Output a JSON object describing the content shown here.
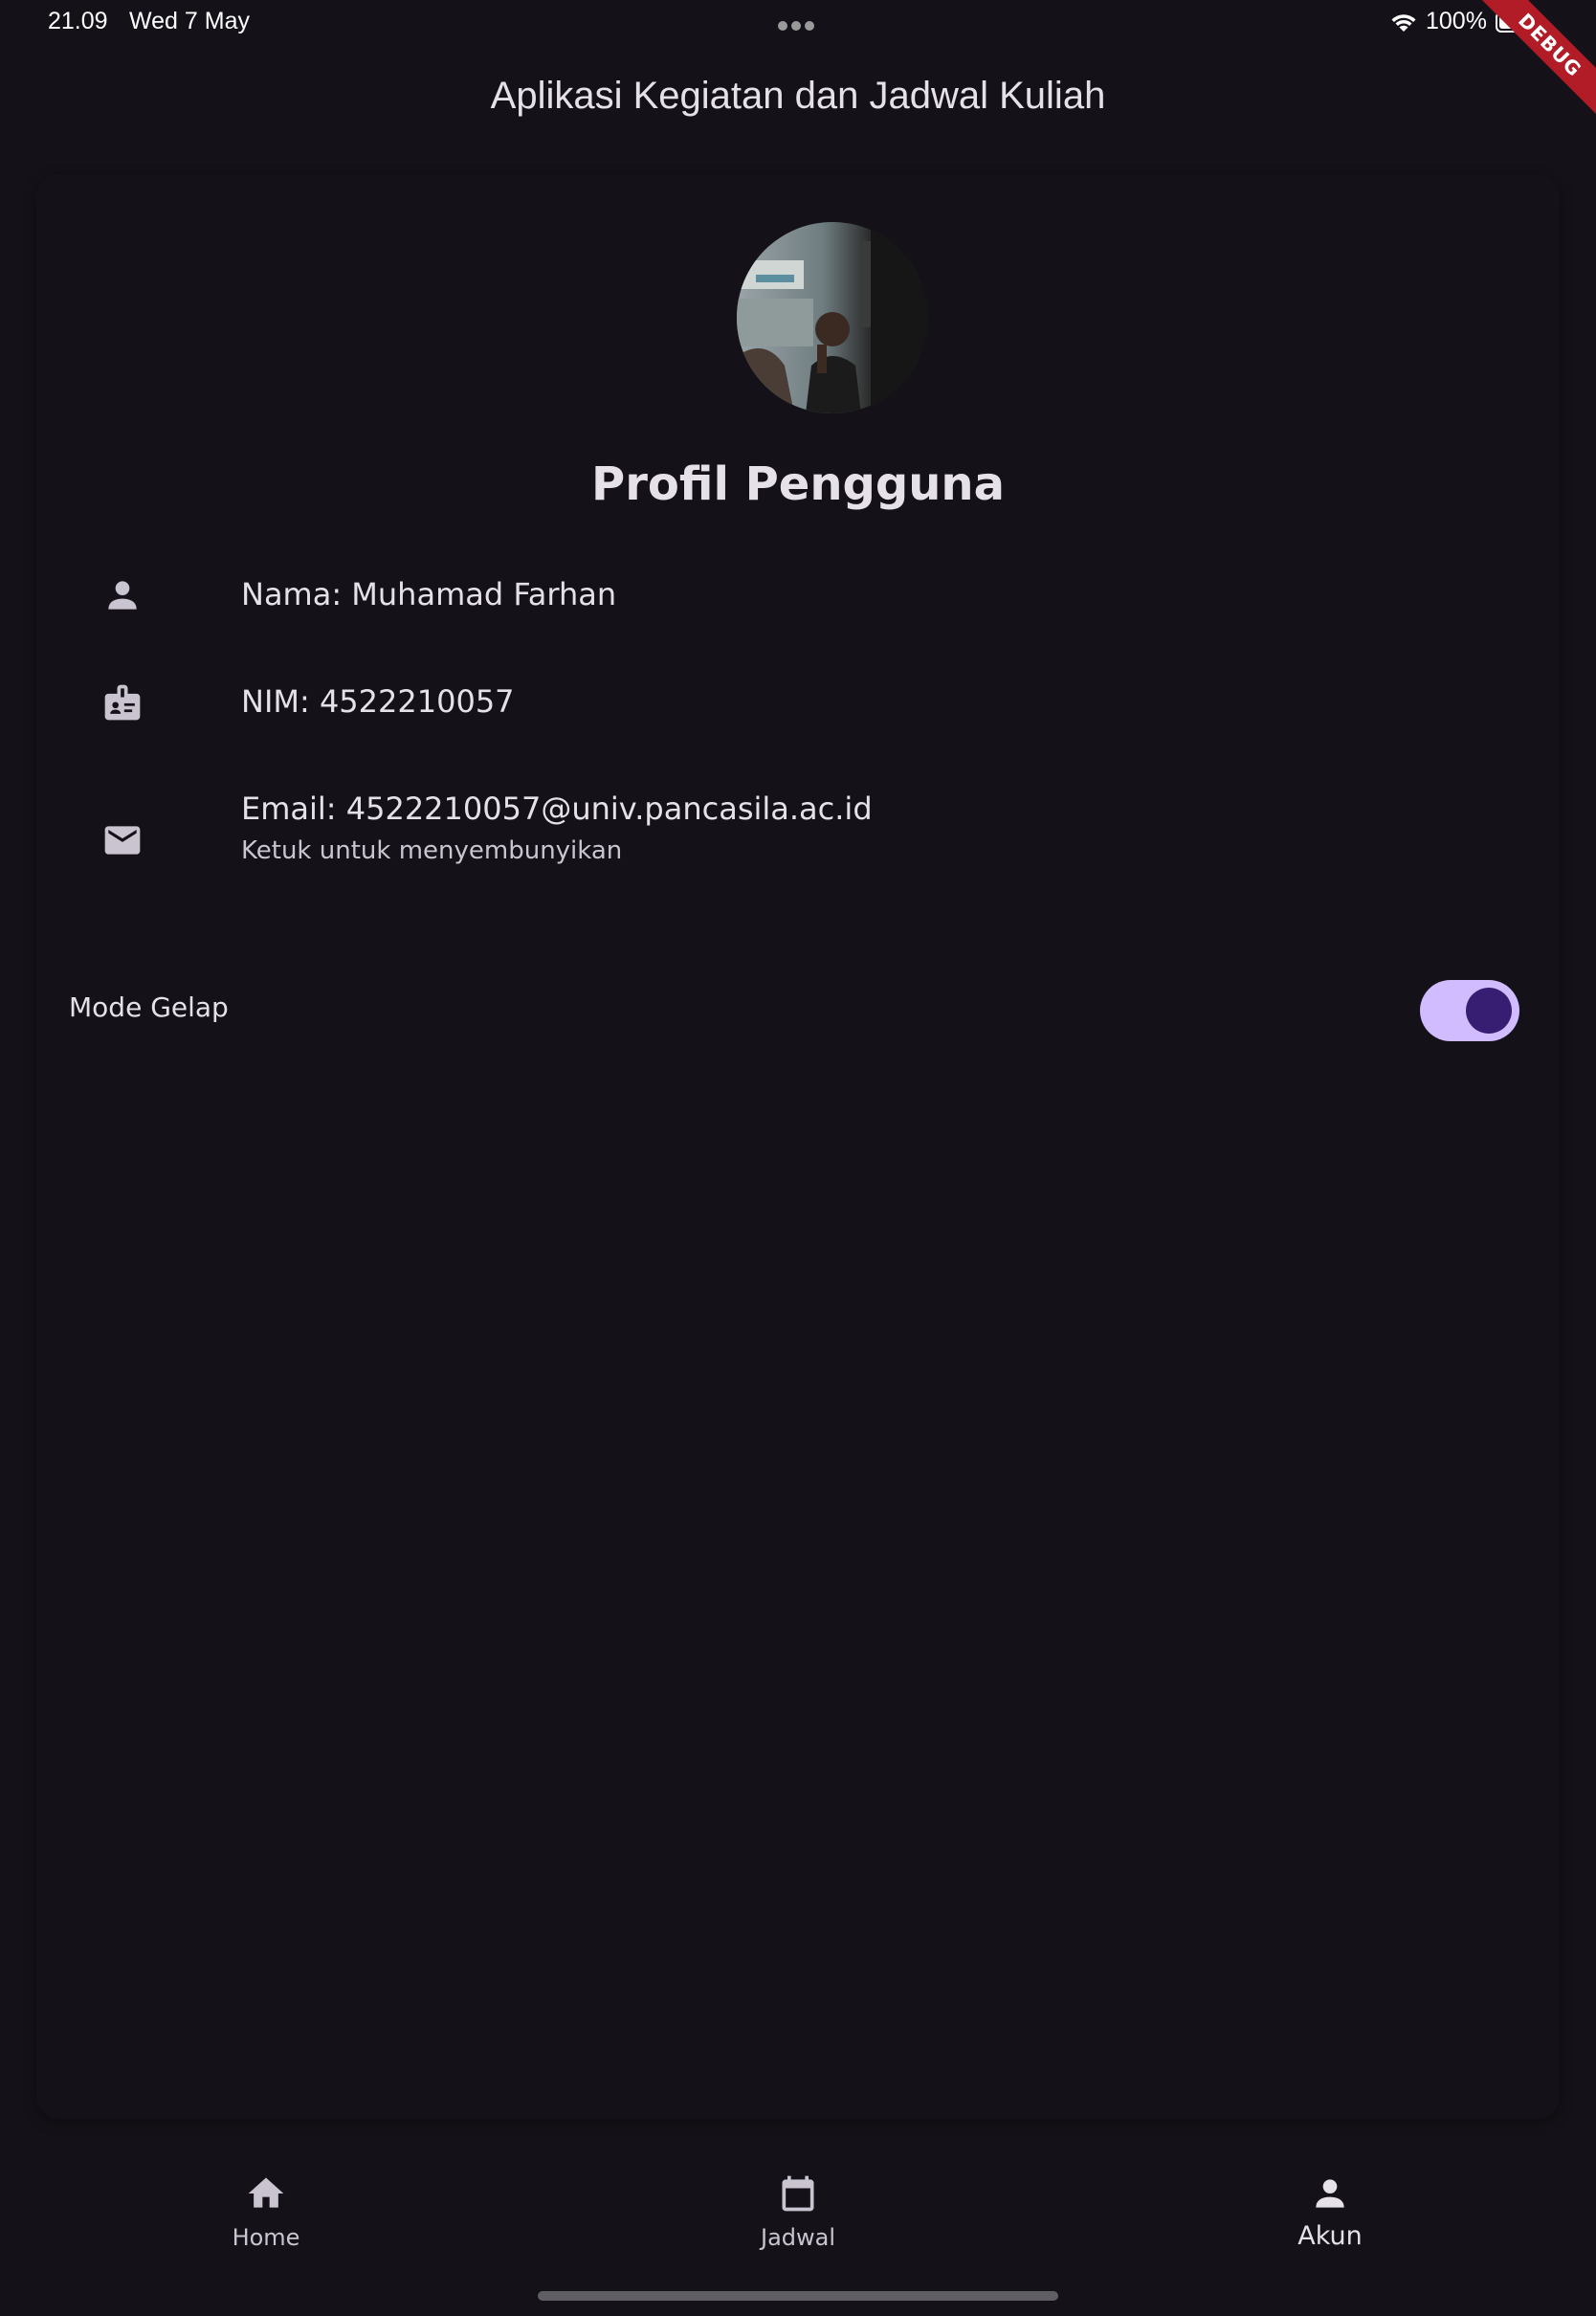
{
  "status_bar": {
    "time": "21.09",
    "date": "Wed 7 May",
    "battery_percent": "100%",
    "battery_level": 1.0,
    "wifi_icon": "wifi-icon",
    "battery_icon": "battery-icon"
  },
  "debug_banner": "DEBUG",
  "app_bar": {
    "title": "Aplikasi Kegiatan dan Jadwal Kuliah"
  },
  "profile": {
    "title": "Profil Pengguna",
    "avatar_icon": "avatar-photo",
    "items": [
      {
        "icon": "person-icon",
        "text": "Nama: Muhamad Farhan"
      },
      {
        "icon": "badge-icon",
        "text": "NIM: 4522210057"
      },
      {
        "icon": "email-icon",
        "text": "Email: 4522210057@univ.pancasila.ac.id",
        "subtitle": "Ketuk untuk menyembunyikan"
      }
    ]
  },
  "settings": {
    "dark_mode_label": "Mode Gelap",
    "dark_mode_enabled": true
  },
  "bottom_nav": {
    "items": [
      {
        "icon": "home-icon",
        "label": "Home",
        "active": false
      },
      {
        "icon": "calendar-icon",
        "label": "Jadwal",
        "active": false
      },
      {
        "icon": "person-icon",
        "label": "Akun",
        "active": true
      }
    ]
  },
  "colors": {
    "background": "#141218",
    "on_surface": "#e6e0e9",
    "on_surface_variant": "#cac4d0",
    "switch_track": "#d0bcff",
    "switch_thumb": "#381e72",
    "debug_red": "#b11c26"
  }
}
